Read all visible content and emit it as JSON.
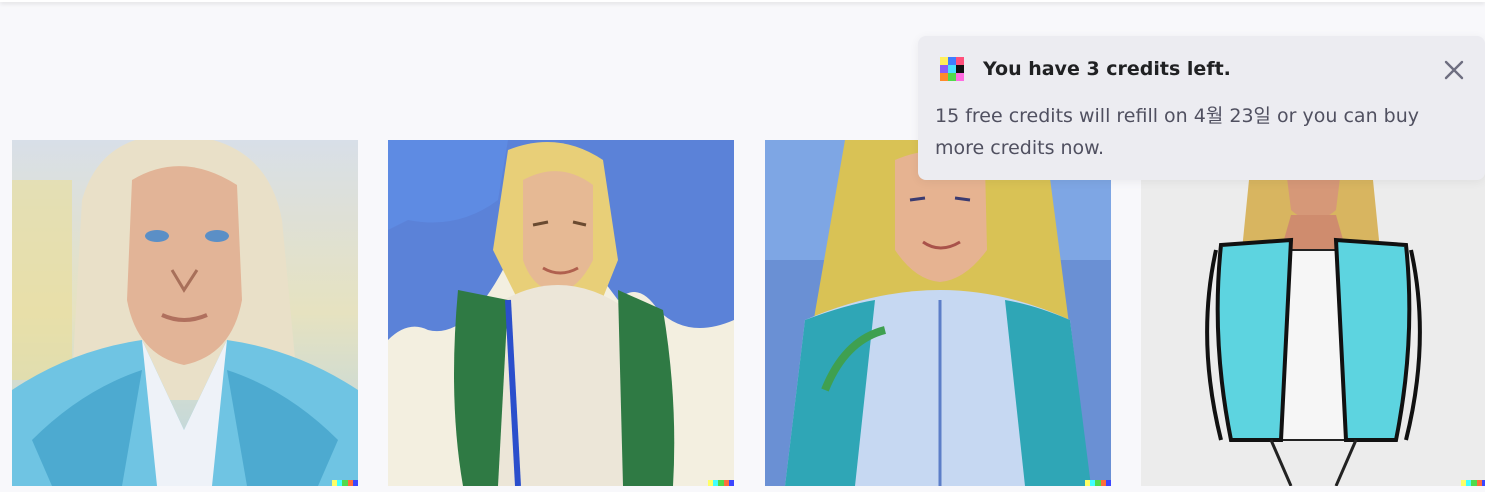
{
  "notification": {
    "title": "You have 3 credits left.",
    "body": "15 free credits will refill on 4월 23일 or you can buy more credits now.",
    "icon": "dalle-logo-icon",
    "close_icon": "close-icon"
  },
  "gallery": {
    "images": [
      {
        "id": "image-1",
        "style": "painted portrait, blonde woman in light blue jacket"
      },
      {
        "id": "image-2",
        "style": "watercolor, blonde woman in green jacket, blue sky"
      },
      {
        "id": "image-3",
        "style": "marker sketch, blonde woman in blue shirt and teal jacket"
      },
      {
        "id": "image-4",
        "style": "fashion sketch, woman in cyan jacket and white outfit"
      }
    ],
    "signature_colors": [
      "#ffff66",
      "#42ffff",
      "#51da4c",
      "#ff6e3c",
      "#3c46ff"
    ]
  },
  "colors": {
    "page_bg": "#f8f8fb",
    "toast_bg": "#ececf1",
    "title_text": "#202123",
    "body_text": "#505060"
  }
}
